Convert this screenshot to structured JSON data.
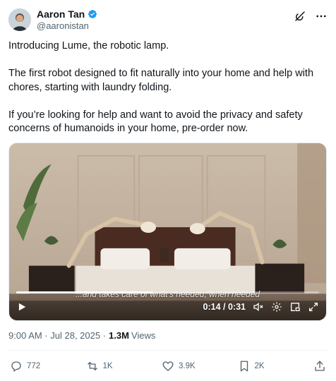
{
  "author": {
    "display_name": "Aaron Tan",
    "handle": "@aaronistan",
    "verified": true,
    "avatar_icon": "avatar-photo"
  },
  "tweet": {
    "paragraphs": [
      "Introducing Lume, the robotic lamp.",
      "The first robot designed to fit naturally into your home and help with chores, starting with laundry folding.",
      "If you’re looking for help and want to avoid the privacy and safety concerns of humanoids in your home, pre-order now."
    ]
  },
  "video": {
    "caption": "...and takes care of what's needed, when needed",
    "time": "0:14 / 0:31",
    "progress": 0.45
  },
  "meta": {
    "timestamp": "9:00 AM · Jul 28, 2025 · ",
    "views_count": "1.3M",
    "views_label": "Views"
  },
  "actions": {
    "replies": "772",
    "reposts": "1K",
    "likes": "3.9K",
    "bookmarks": "2K"
  },
  "colors": {
    "text": "#0f1419",
    "secondary": "#536471",
    "verified": "#1d9bf0"
  }
}
